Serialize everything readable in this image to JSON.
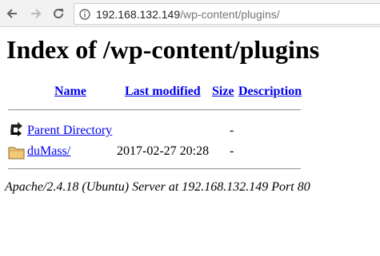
{
  "browser": {
    "url_host": "192.168.132.149",
    "url_path": "/wp-content/plugins/"
  },
  "page": {
    "title": "Index of /wp-content/plugins",
    "columns": {
      "name": "Name",
      "last_modified": "Last modified",
      "size": "Size",
      "description": "Description"
    },
    "rows": [
      {
        "icon": "back-arrow-icon",
        "name": "Parent Directory",
        "last_modified": "",
        "size": "-",
        "description": ""
      },
      {
        "icon": "folder-icon",
        "name": "duMass/",
        "last_modified": "2017-02-27 20:28",
        "size": "-",
        "description": ""
      }
    ],
    "footer": "Apache/2.4.18 (Ubuntu) Server at 192.168.132.149 Port 80"
  }
}
